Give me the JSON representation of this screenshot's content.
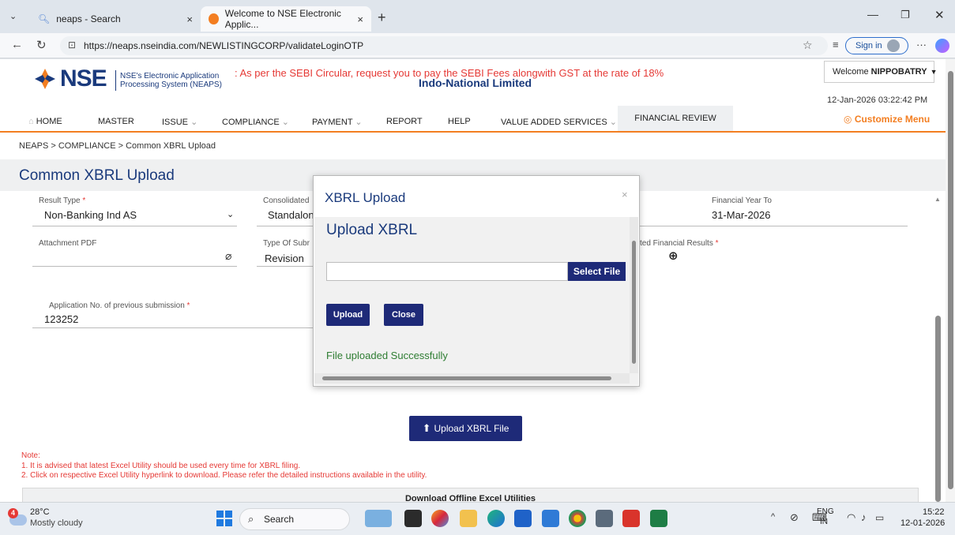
{
  "browser": {
    "tabs": [
      {
        "label": "neaps - Search",
        "close": "×"
      },
      {
        "label": "Welcome to NSE Electronic Applic...",
        "close": "×"
      }
    ],
    "new_tab": "+",
    "url": "https://neaps.nseindia.com/NEWLISTINGCORP/validateLoginOTP",
    "sign_in": "Sign in",
    "more": "···"
  },
  "header": {
    "logo_text": "NSE",
    "logo_sub_line1": "NSE's Electronic Application",
    "logo_sub_line2": "Processing System (NEAPS)",
    "marquee": ": As per the SEBI Circular, request you to pay the SEBI Fees alongwith GST at the rate of 18%",
    "company": "Indo-National Limited",
    "welcome_prefix": "Welcome ",
    "welcome_user": "NIPPOBATRY",
    "datetime": "12-Jan-2026 03:22:42 PM",
    "customize": "Customize Menu"
  },
  "nav": {
    "home": "HOME",
    "master": "MASTER",
    "issue": "ISSUE",
    "compliance": "COMPLIANCE",
    "payment": "PAYMENT",
    "report": "REPORT",
    "help": "HELP",
    "vas": "VALUE ADDED SERVICES",
    "financial_review": "FINANCIAL REVIEW"
  },
  "breadcrumb": "NEAPS > COMPLIANCE > Common XBRL Upload",
  "page_title": "Common XBRL Upload",
  "form": {
    "result_type_label": "Result Type",
    "result_type_value": "Non-Banking Ind AS",
    "consolidated_label": "Consolidated",
    "consolidated_value": "Standalon",
    "fy_to_label": "Financial Year To",
    "fy_to_value": "31-Mar-2026",
    "attachment_label": "Attachment PDF",
    "type_sub_label": "Type Of Subr",
    "type_sub_value": "Revision",
    "financial_results_label": "ted Financial Results",
    "app_no_label": "Application No. of previous submission",
    "app_no_value": "123252",
    "required_mark": "*"
  },
  "modal": {
    "title": "XBRL Upload",
    "close_x": "×",
    "heading": "Upload XBRL",
    "select_file": "Select File",
    "upload": "Upload",
    "close": "Close",
    "success": "File uploaded Successfully"
  },
  "upload_xbrl_button": "Upload XBRL File",
  "notes": {
    "label": "Note:",
    "line1": "1. It is advised that latest Excel Utility should be used every time for XBRL filing.",
    "line2": "2. Click on respective Excel Utility hyperlink to download. Please refer the detailed instructions available in the utility."
  },
  "download_bar": "Download Offline Excel Utilities",
  "taskbar": {
    "badge": "4",
    "temperature": "28°C",
    "weather": "Mostly cloudy",
    "search": "Search",
    "lang1": "ENG",
    "lang2": "IN",
    "time": "15:22",
    "date": "12-01-2026"
  },
  "colors": {
    "brand_blue": "#1a3a7c",
    "button_navy": "#1e2a78",
    "accent_orange": "#f37e21",
    "alert_red": "#e53935",
    "success_green": "#2e7d32"
  }
}
